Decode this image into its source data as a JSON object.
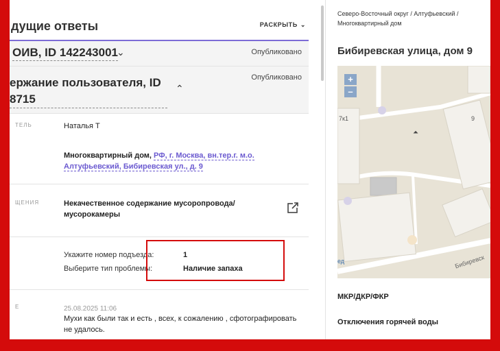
{
  "left": {
    "section_title": "дущие ответы",
    "expand_label": "РАСКРЫТЬ",
    "row1": {
      "title": "ОИВ, ID 142243001",
      "status": "Опубликовано"
    },
    "row2": {
      "title_line1": "ержание пользователя, ID",
      "title_line2": "8715",
      "status": "Опубликовано"
    },
    "author": {
      "label": "ТЕЛЬ",
      "value": "Наталья Т"
    },
    "object": {
      "type": "Многоквартирный дом, ",
      "address": "РФ, г. Москва, вн.тер.г. м.о. Алтуфьевский, Бибиревская ул., д. 9"
    },
    "problem": {
      "label": "ЩЕНИЯ",
      "value": "Некачественное содержание мусоропровода/ мусорокамеры"
    },
    "fields": [
      {
        "label": "Укажите номер подъезда:",
        "value": "1"
      },
      {
        "label": "Выберите тип проблемы:",
        "value": "Наличие запаха"
      }
    ],
    "comment": {
      "label": "Е",
      "date": "25.08.2025 11:06",
      "text": "Мухи как были так и есть , всех, к сожалению , сфотографировать не удалось."
    }
  },
  "right": {
    "breadcrumb": "Северо-Восточный округ / Алтуфьевский / Многоквартирный дом",
    "title": "Бибиревская улица, дом 9",
    "map": {
      "zoom_in": "+",
      "zoom_out": "–",
      "labels": {
        "building_a": "7к1",
        "building_b": "9",
        "street": "Бибиревск",
        "edge": "ед"
      }
    },
    "district_label": "МКР/ДКР/ФКР",
    "hot_water_label": "Отключения горячей воды"
  },
  "colors": {
    "frame": "#d40b0b",
    "accent": "#7c6bd6",
    "link": "#6b5ad0"
  }
}
